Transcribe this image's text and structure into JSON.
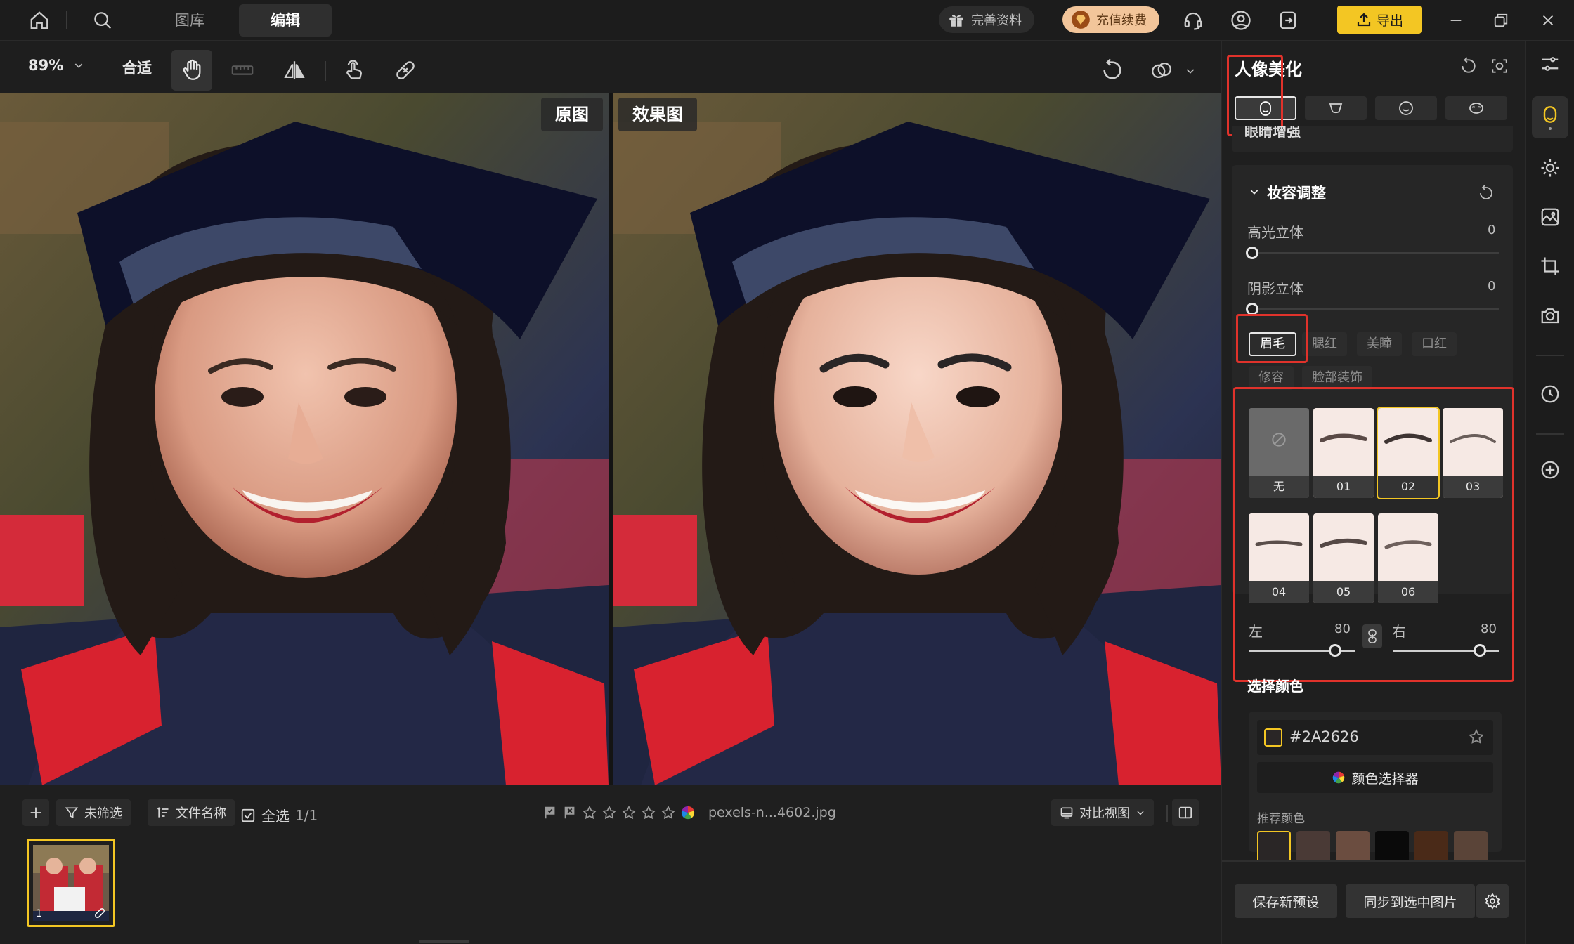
{
  "topbar": {
    "tabs": [
      {
        "label": "图库"
      },
      {
        "label": "编辑"
      }
    ],
    "complete_profile": "完善资料",
    "recharge": "充值续费",
    "export": "导出"
  },
  "toolbar": {
    "zoom": "89%",
    "fit": "合适"
  },
  "canvas": {
    "original_label": "原图",
    "effect_label": "效果图"
  },
  "bottombar": {
    "filter": "未筛选",
    "sort": "文件名称",
    "select_all": "全选",
    "count": "1/1",
    "filename": "pexels-n...4602.jpg",
    "compare_view": "对比视图",
    "thumb_index": "1"
  },
  "panel": {
    "title": "人像美化",
    "partial_section": "眼睛增强",
    "makeup_section": "妆容调整",
    "highlight_label": "高光立体",
    "highlight_value": "0",
    "shadow_label": "阴影立体",
    "shadow_value": "0",
    "subtabs": [
      {
        "label": "眉毛"
      },
      {
        "label": "腮红"
      },
      {
        "label": "美瞳"
      },
      {
        "label": "口红"
      },
      {
        "label": "修容"
      },
      {
        "label": "脸部装饰"
      }
    ],
    "eyebrow_tiles": [
      {
        "label": "无"
      },
      {
        "label": "01"
      },
      {
        "label": "02"
      },
      {
        "label": "03"
      },
      {
        "label": "04"
      },
      {
        "label": "05"
      },
      {
        "label": "06"
      }
    ],
    "selected_tile": "02",
    "left_label": "左",
    "left_value": "80",
    "right_label": "右",
    "right_value": "80",
    "color_section": "选择颜色",
    "color_hex": "#2A2626",
    "color_picker": "颜色选择器",
    "recommended_colors": "推荐颜色",
    "swatches": [
      "#2a2626",
      "#4a3a36",
      "#6b4d40",
      "#0a0a0a",
      "#4a2a18",
      "#5a4438"
    ],
    "save_preset": "保存新预设",
    "sync": "同步到选中图片"
  },
  "colors": {
    "accent_yellow": "#f3c623",
    "highlight_red": "#e0322b",
    "recharge_bg": "#f2c59a"
  }
}
